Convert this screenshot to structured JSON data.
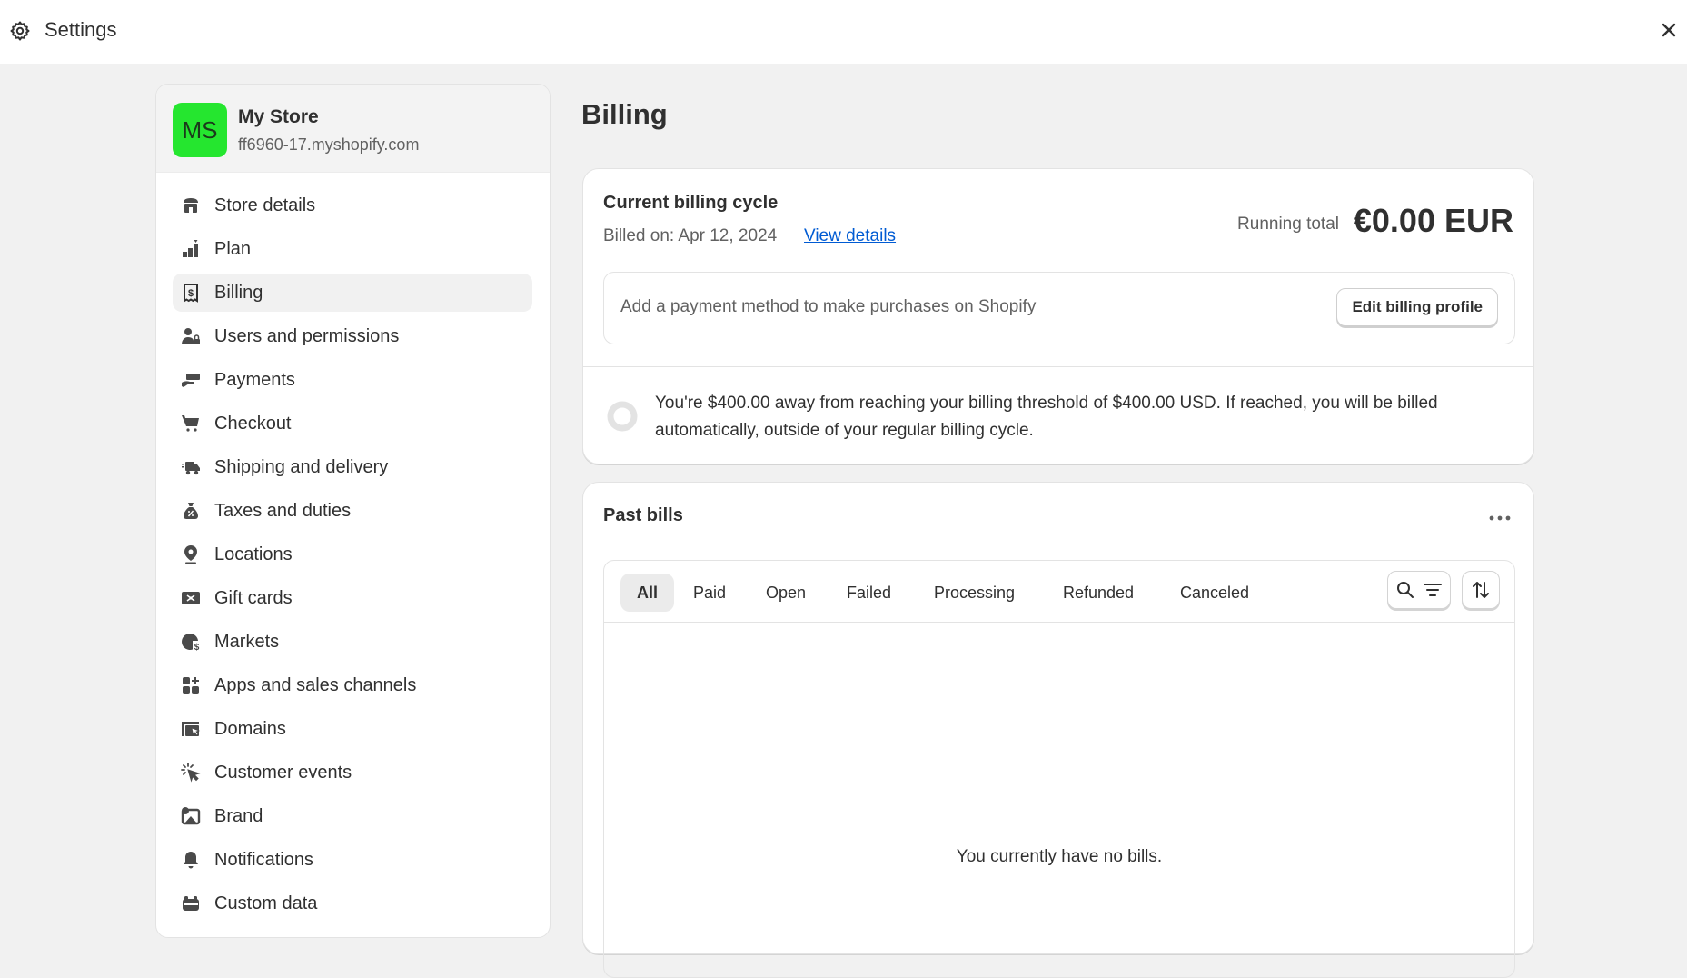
{
  "window": {
    "title": "Settings",
    "icon": "gear-icon",
    "close_icon": "close-icon"
  },
  "store": {
    "initials": "MS",
    "name": "My Store",
    "url": "ff6960-17.myshopify.com",
    "avatar_color": "#25e62f"
  },
  "sidebar": {
    "items": [
      {
        "label": "Store details",
        "icon": "store-icon",
        "active": false
      },
      {
        "label": "Plan",
        "icon": "plan-icon",
        "active": false
      },
      {
        "label": "Billing",
        "icon": "receipt-dollar-icon",
        "active": true
      },
      {
        "label": "Users and permissions",
        "icon": "user-lock-icon",
        "active": false
      },
      {
        "label": "Payments",
        "icon": "hand-card-icon",
        "active": false
      },
      {
        "label": "Checkout",
        "icon": "cart-icon",
        "active": false
      },
      {
        "label": "Shipping and delivery",
        "icon": "truck-icon",
        "active": false
      },
      {
        "label": "Taxes and duties",
        "icon": "money-bag-percent-icon",
        "active": false
      },
      {
        "label": "Locations",
        "icon": "location-pin-icon",
        "active": false
      },
      {
        "label": "Gift cards",
        "icon": "gift-card-icon",
        "active": false
      },
      {
        "label": "Markets",
        "icon": "globe-dollar-icon",
        "active": false
      },
      {
        "label": "Apps and sales channels",
        "icon": "apps-icon",
        "active": false
      },
      {
        "label": "Domains",
        "icon": "domain-cursor-icon",
        "active": false
      },
      {
        "label": "Customer events",
        "icon": "cursor-click-icon",
        "active": false
      },
      {
        "label": "Brand",
        "icon": "brand-image-icon",
        "active": false
      },
      {
        "label": "Notifications",
        "icon": "bell-icon",
        "active": false
      },
      {
        "label": "Custom data",
        "icon": "custom-data-icon",
        "active": false
      }
    ]
  },
  "main": {
    "title": "Billing",
    "current_cycle": {
      "title": "Current billing cycle",
      "billed_on": "Billed on: Apr 12, 2024",
      "view_details": "View details",
      "running_total_label": "Running total",
      "running_total_value": "€0.00 EUR",
      "payment_prompt": "Add a payment method to make purchases on Shopify",
      "edit_button": "Edit billing profile",
      "threshold_message": "You're $400.00 away from reaching your billing threshold of $400.00 USD. If reached, you will be billed automatically, outside of your regular billing cycle.",
      "threshold_progress_percent": 0
    },
    "past_bills": {
      "title": "Past bills",
      "more_icon": "more-horizontal-icon",
      "tabs": [
        {
          "label": "All",
          "active": true
        },
        {
          "label": "Paid",
          "active": false
        },
        {
          "label": "Open",
          "active": false
        },
        {
          "label": "Failed",
          "active": false
        },
        {
          "label": "Processing",
          "active": false
        },
        {
          "label": "Refunded",
          "active": false
        },
        {
          "label": "Canceled",
          "active": false
        }
      ],
      "empty_message": "You currently have no bills."
    }
  },
  "colors": {
    "link": "#005bd3",
    "page_bg": "#f1f1f1",
    "text": "#303030",
    "muted": "#616161"
  }
}
